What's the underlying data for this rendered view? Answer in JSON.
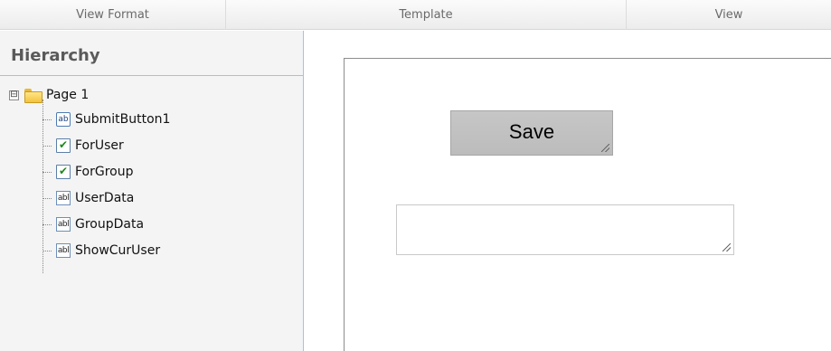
{
  "tabs": [
    {
      "label": "View Format"
    },
    {
      "label": "Template"
    },
    {
      "label": "View"
    }
  ],
  "hierarchy": {
    "title": "Hierarchy",
    "root": {
      "label": "Page 1",
      "expander": "⊟"
    },
    "items": [
      {
        "label": "SubmitButton1",
        "icon": "button-icon",
        "icon_text": "ab"
      },
      {
        "label": "ForUser",
        "icon": "checkbox-icon",
        "icon_text": "✔"
      },
      {
        "label": "ForGroup",
        "icon": "checkbox-icon",
        "icon_text": "✔"
      },
      {
        "label": "UserData",
        "icon": "textbox-icon",
        "icon_text": "abl"
      },
      {
        "label": "GroupData",
        "icon": "textbox-icon",
        "icon_text": "abl"
      },
      {
        "label": "ShowCurUser",
        "icon": "textbox-icon",
        "icon_text": "abl"
      }
    ]
  },
  "canvas": {
    "save_button_label": "Save",
    "textbox_value": ""
  }
}
